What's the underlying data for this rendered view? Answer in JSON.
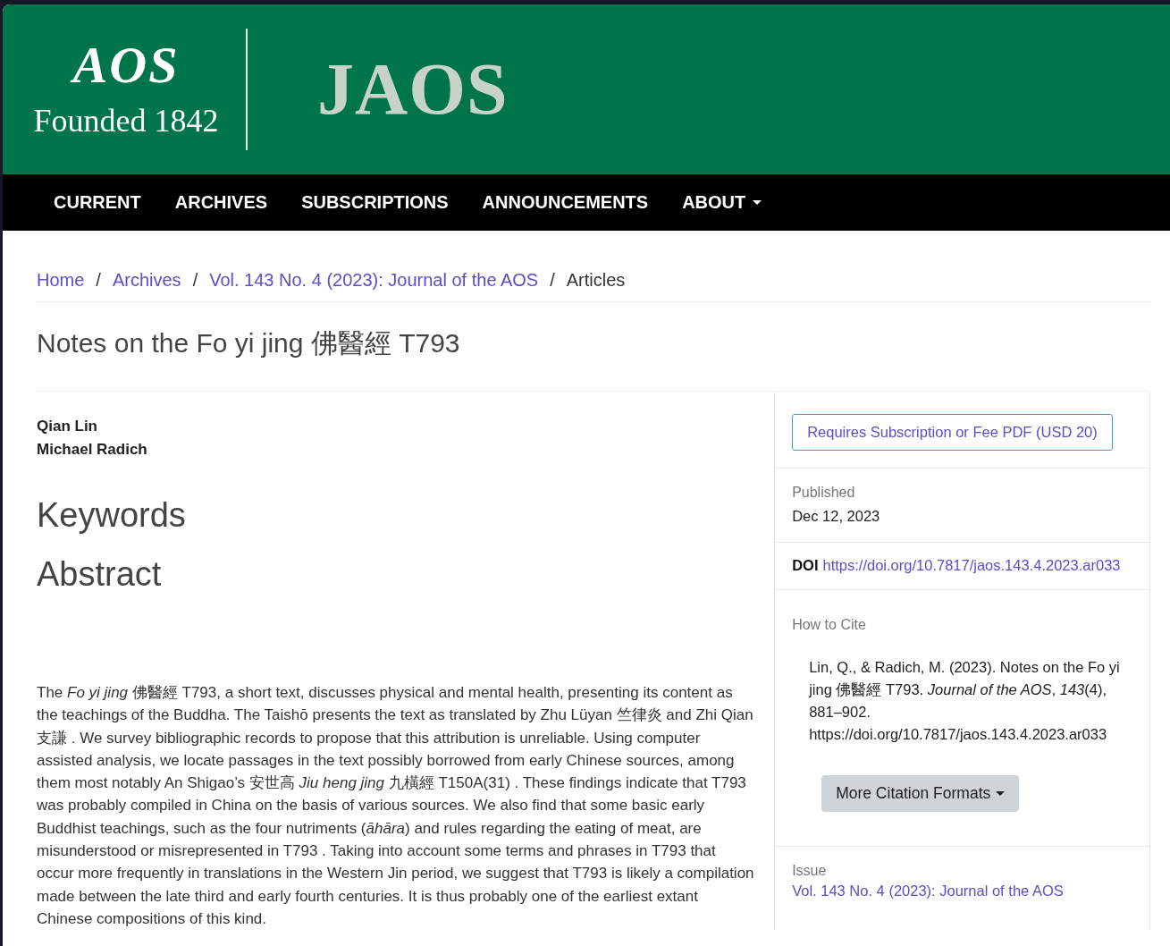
{
  "header": {
    "logo_mark": "AOS",
    "founded": "Founded 1842",
    "journal": "JAOS"
  },
  "nav": [
    {
      "label": "CURRENT",
      "has_menu": false
    },
    {
      "label": "ARCHIVES",
      "has_menu": false
    },
    {
      "label": "SUBSCRIPTIONS",
      "has_menu": false
    },
    {
      "label": "ANNOUNCEMENTS",
      "has_menu": false
    },
    {
      "label": "ABOUT",
      "has_menu": true
    }
  ],
  "breadcrumb": [
    {
      "kind": "link",
      "text": "Home"
    },
    {
      "kind": "separator",
      "text": "/"
    },
    {
      "kind": "link",
      "text": "Archives"
    },
    {
      "kind": "separator",
      "text": "/"
    },
    {
      "kind": "link",
      "text": "Vol. 143 No. 4 (2023): Journal of the AOS"
    },
    {
      "kind": "separator",
      "text": "/"
    },
    {
      "kind": "current",
      "text": "Articles"
    }
  ],
  "article": {
    "title": "Notes on the Fo yi jing 佛醫經 T793",
    "authors": [
      "Qian Lin",
      "Michael Radich"
    ],
    "keywords_heading": "Keywords",
    "abstract_heading": "Abstract",
    "abstract": "The *Fo yi jing* 佛醫經 T793, a short text, discusses physical and mental health, presenting its content as the teachings of the Buddha. The Taishō presents the text as translated by Zhu Lüyan 竺律炎 and Zhi Qian 支謙 . We survey bibliographic records to propose that this attribution is unreliable. Using computer assisted analysis, we locate passages in the text possibly borrowed from early Chinese sources, among them most notably An Shigao’s 安世高 *Jiu heng jing* 九橫經 T150A(31) . These findings indicate that T793 was probably compiled in China on the basis of various sources. We also find that some basic early Buddhist teachings, such as the four nutriments (*āhāra*) and rules regarding the eating of meat, are misunderstood or misrepresented in T793 . Taking into account some terms and phrases in T793 that occur more frequently in translations in the Western Jin period, we suggest that T793 is likely a compilation made between the late third and early fourth centuries. It is thus probably one of the earliest extant Chinese compositions of this kind."
  },
  "sidebar": {
    "pdf_button": "Requires Subscription or Fee PDF (USD 20)",
    "published_label": "Published",
    "published_date": "Dec 12, 2023",
    "doi_label": "DOI",
    "doi_link": "https://doi.org/10.7817/jaos.143.4.2023.ar033",
    "cite_label": "How to Cite",
    "citation": "Lin, Q., & Radich, M. (2023). Notes on the Fo yi jing 佛醫經 T793. *Journal of the AOS*, *143*(4), 881–902. https://doi.org/10.7817/jaos.143.4.2023.ar033",
    "citation_button": "More Citation Formats",
    "issue_label": "Issue",
    "issue_link": "Vol. 143 No. 4 (2023): Journal of the AOS"
  }
}
